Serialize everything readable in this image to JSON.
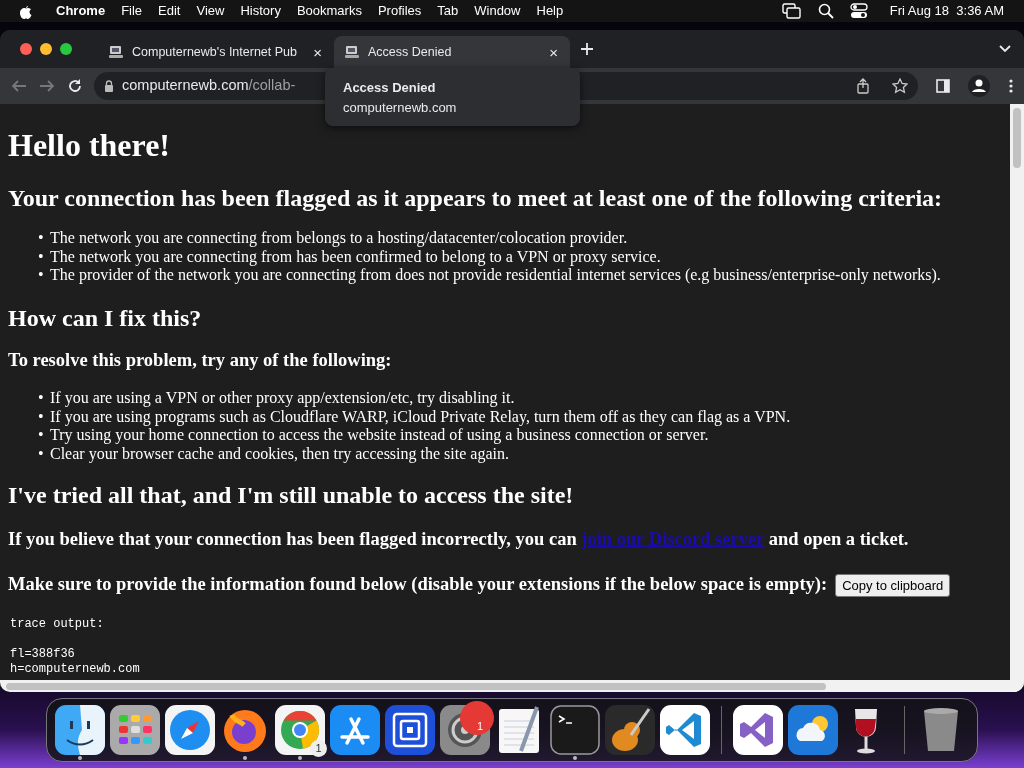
{
  "menubar": {
    "app": "Chrome",
    "items": [
      "File",
      "Edit",
      "View",
      "History",
      "Bookmarks",
      "Profiles",
      "Tab",
      "Window",
      "Help"
    ],
    "clock": "Fri Aug 18  3:36 AM"
  },
  "tabs": [
    {
      "title": "Computernewb's Internet Pub",
      "selected": false,
      "close": "×"
    },
    {
      "title": "Access Denied",
      "selected": true,
      "close": "×"
    }
  ],
  "tooltip": {
    "title": "Access Denied",
    "url": "computernewb.com"
  },
  "address": {
    "host": "computernewb.com",
    "path": "/collab-"
  },
  "page": {
    "heading": "Hello there!",
    "criteria_heading": "Your connection has been flagged as it appears to meet at least one of the following criteria:",
    "criteria": [
      {
        "bullet": "•",
        "text": "The network you are connecting from belongs to a hosting/datacenter/colocation provider."
      },
      {
        "bullet": "•",
        "text": "The network you are connecting from has been confirmed to belong to a VPN or proxy service."
      },
      {
        "bullet": "•",
        "text": "The provider of the network you are connecting from does not provide residential internet services (e.g business/enterprise-only networks)."
      }
    ],
    "fix_heading": "How can I fix this?",
    "resolve_heading": "To resolve this problem, try any of the following:",
    "steps": [
      {
        "bullet": "•",
        "text": "If you are using a VPN or other proxy app/extension/etc, try disabling it."
      },
      {
        "bullet": "•",
        "text": "If you are using programs such as Cloudflare WARP, iCloud Private Relay, turn them off as they can flag as a VPN."
      },
      {
        "bullet": "•",
        "text": "Try using your home connection to access the website instead of using a business connection or server."
      },
      {
        "bullet": "•",
        "text": "Clear your browser cache and cookies, then try accessing the site again."
      }
    ],
    "tried_heading": "I've tried all that, and I'm still unable to access the site!",
    "ticket": {
      "before": "If you believe that your connection has been flagged incorrectly, you can",
      "link": "join our Discord server",
      "after": "and open a ticket."
    },
    "provide": "Make sure to provide the information found below (disable your extensions if the below space is empty):",
    "copy_button": "Copy to clipboard",
    "trace": {
      "label": "trace output:",
      "lines": [
        "fl=388f36",
        "h=computernewb.com"
      ]
    }
  },
  "dock": [
    {
      "kind": "finder",
      "running": true
    },
    {
      "kind": "launchpad",
      "running": false
    },
    {
      "kind": "safari",
      "running": false
    },
    {
      "kind": "firefox",
      "running": true
    },
    {
      "kind": "chrome",
      "running": true,
      "badge": {
        "text": "1",
        "kind": "count"
      }
    },
    {
      "kind": "appstore",
      "running": false
    },
    {
      "kind": "squares",
      "running": false
    },
    {
      "kind": "settings",
      "running": false,
      "badge": {
        "text": "1",
        "kind": "alert"
      }
    },
    {
      "kind": "textedit",
      "running": false
    },
    {
      "kind": "terminal",
      "running": true
    },
    {
      "kind": "guitar",
      "running": false
    },
    {
      "kind": "vscode",
      "running": false
    },
    {
      "kind": "separator"
    },
    {
      "kind": "visualstudio",
      "running": false
    },
    {
      "kind": "weather",
      "running": false
    },
    {
      "kind": "wine",
      "running": false
    },
    {
      "kind": "separator"
    },
    {
      "kind": "trash",
      "running": false
    }
  ]
}
